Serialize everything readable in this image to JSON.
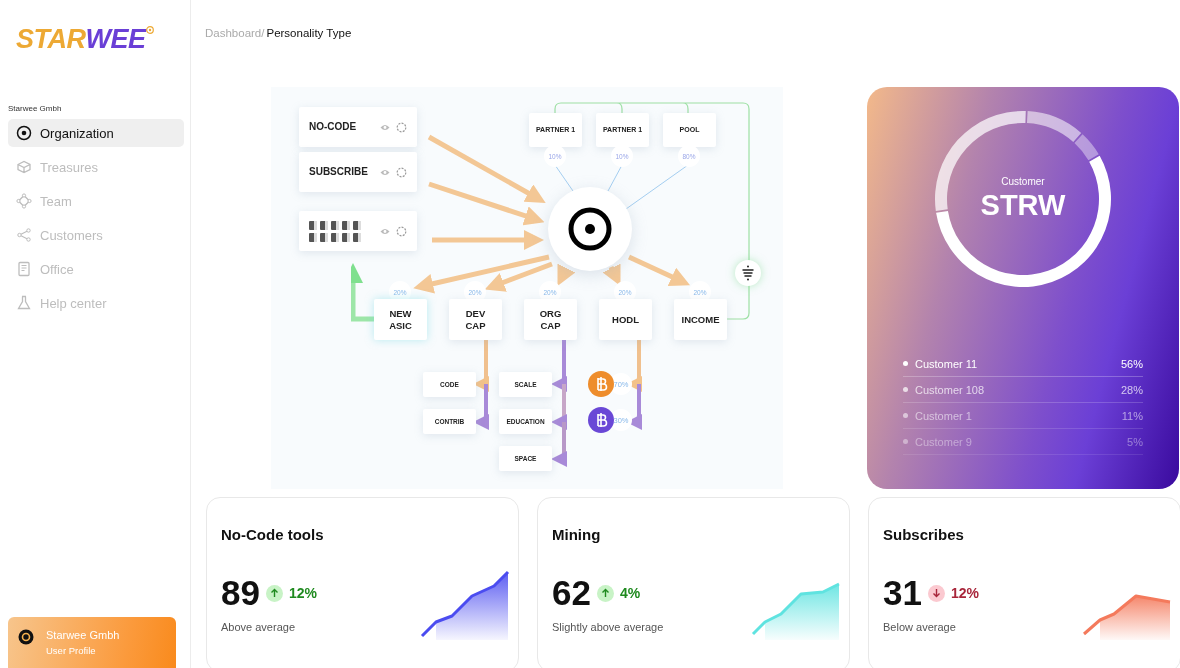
{
  "logo": {
    "part_1": "STAR",
    "part_2": "WEE"
  },
  "sidebar": {
    "org_label": "Starwee Gmbh",
    "items": [
      {
        "label": "Organization",
        "selected": true
      },
      {
        "label": "Treasures",
        "selected": false
      },
      {
        "label": "Team",
        "selected": false
      },
      {
        "label": "Customers",
        "selected": false
      },
      {
        "label": "Office",
        "selected": false
      },
      {
        "label": "Help center",
        "selected": false
      }
    ],
    "profile": {
      "name": "Starwee Gmbh",
      "role": "User Profile"
    }
  },
  "breadcrumb": {
    "parent": "Dashboard/",
    "current": "Personality Type"
  },
  "diagram": {
    "sources": [
      {
        "kind": "text",
        "label": "NO-CODE"
      },
      {
        "kind": "text",
        "label": "SUBSCRIBE"
      },
      {
        "kind": "miners"
      }
    ],
    "partners": [
      {
        "label": "PARTNER 1",
        "share": "10%"
      },
      {
        "label": "PARTNER 1",
        "share": "10%"
      },
      {
        "label": "POOL",
        "share": "80%"
      }
    ],
    "outputs": [
      {
        "lines": [
          "NEW",
          "ASIC"
        ],
        "share": "20%"
      },
      {
        "lines": [
          "DEV",
          "CAP"
        ],
        "share": "20%"
      },
      {
        "lines": [
          "ORG",
          "CAP"
        ],
        "share": "20%"
      },
      {
        "lines": [
          "HODL"
        ],
        "share": "20%"
      },
      {
        "lines": [
          "INCOME"
        ],
        "share": "20%"
      }
    ],
    "sub_nodes": [
      "CODE",
      "CONTRIB",
      "SCALE",
      "EDUCATION",
      "SPACE"
    ],
    "coins": [
      {
        "color": "#ee8d2c",
        "share": "70%"
      },
      {
        "color": "#6a48d6",
        "share": "30%"
      }
    ]
  },
  "customer_card": {
    "caption": "Customer",
    "value": "STRW",
    "legend": [
      {
        "share": "56%"
      },
      {
        "share": "28%"
      },
      {
        "share": "11%"
      },
      {
        "share": "5%"
      }
    ],
    "chart_data": {
      "type": "donut",
      "categories": [
        "Customer 11",
        "Customer 108",
        "Customer 1",
        "Customer 9"
      ],
      "values": [
        56,
        28,
        11,
        5
      ]
    }
  },
  "stats": [
    {
      "title": "No-Code tools",
      "value": "89",
      "rising": true,
      "change": "12%",
      "subtitle": "Above average",
      "color": "#4b4cf0"
    },
    {
      "title": "Mining",
      "value": "62",
      "rising": true,
      "change": "4%",
      "subtitle": "Slightly above average",
      "color": "#5fe3e0"
    },
    {
      "title": "Subscribes",
      "value": "31",
      "rising": false,
      "change": "12%",
      "subtitle": "Below average",
      "color": "#f47a5c"
    }
  ]
}
